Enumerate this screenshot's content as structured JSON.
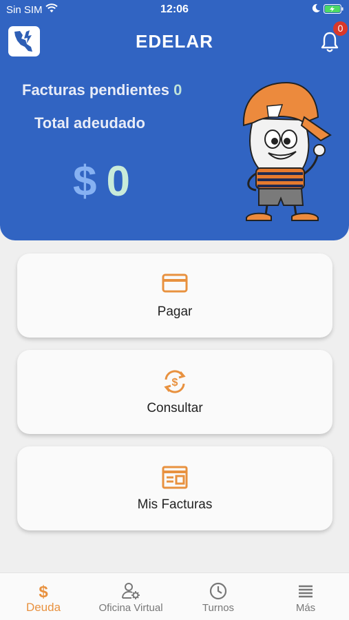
{
  "status_bar": {
    "carrier": "Sin SIM",
    "time": "12:06"
  },
  "header": {
    "title": "EDELAR",
    "notifications_count": "0",
    "pending_label": "Facturas pendientes",
    "pending_count": "0",
    "total_label": "Total adeudado",
    "currency": "$",
    "total_amount": "0"
  },
  "actions": [
    {
      "label": "Pagar",
      "icon": "credit-card-icon"
    },
    {
      "label": "Consultar",
      "icon": "dollar-refresh-icon"
    },
    {
      "label": "Mis Facturas",
      "icon": "invoice-icon"
    }
  ],
  "tabbar": {
    "active": "Deuda",
    "items": [
      {
        "label": "Deuda",
        "icon": "dollar-icon"
      },
      {
        "label": "Oficina Virtual",
        "icon": "user-settings-icon"
      },
      {
        "label": "Turnos",
        "icon": "clock-icon"
      },
      {
        "label": "Más",
        "icon": "menu-icon"
      }
    ]
  },
  "colors": {
    "header_bg": "#3164c2",
    "accent": "#e8913f",
    "badge": "#d9382a",
    "amount_currency": "#86b1f2",
    "amount_value": "#c9ebd9"
  }
}
